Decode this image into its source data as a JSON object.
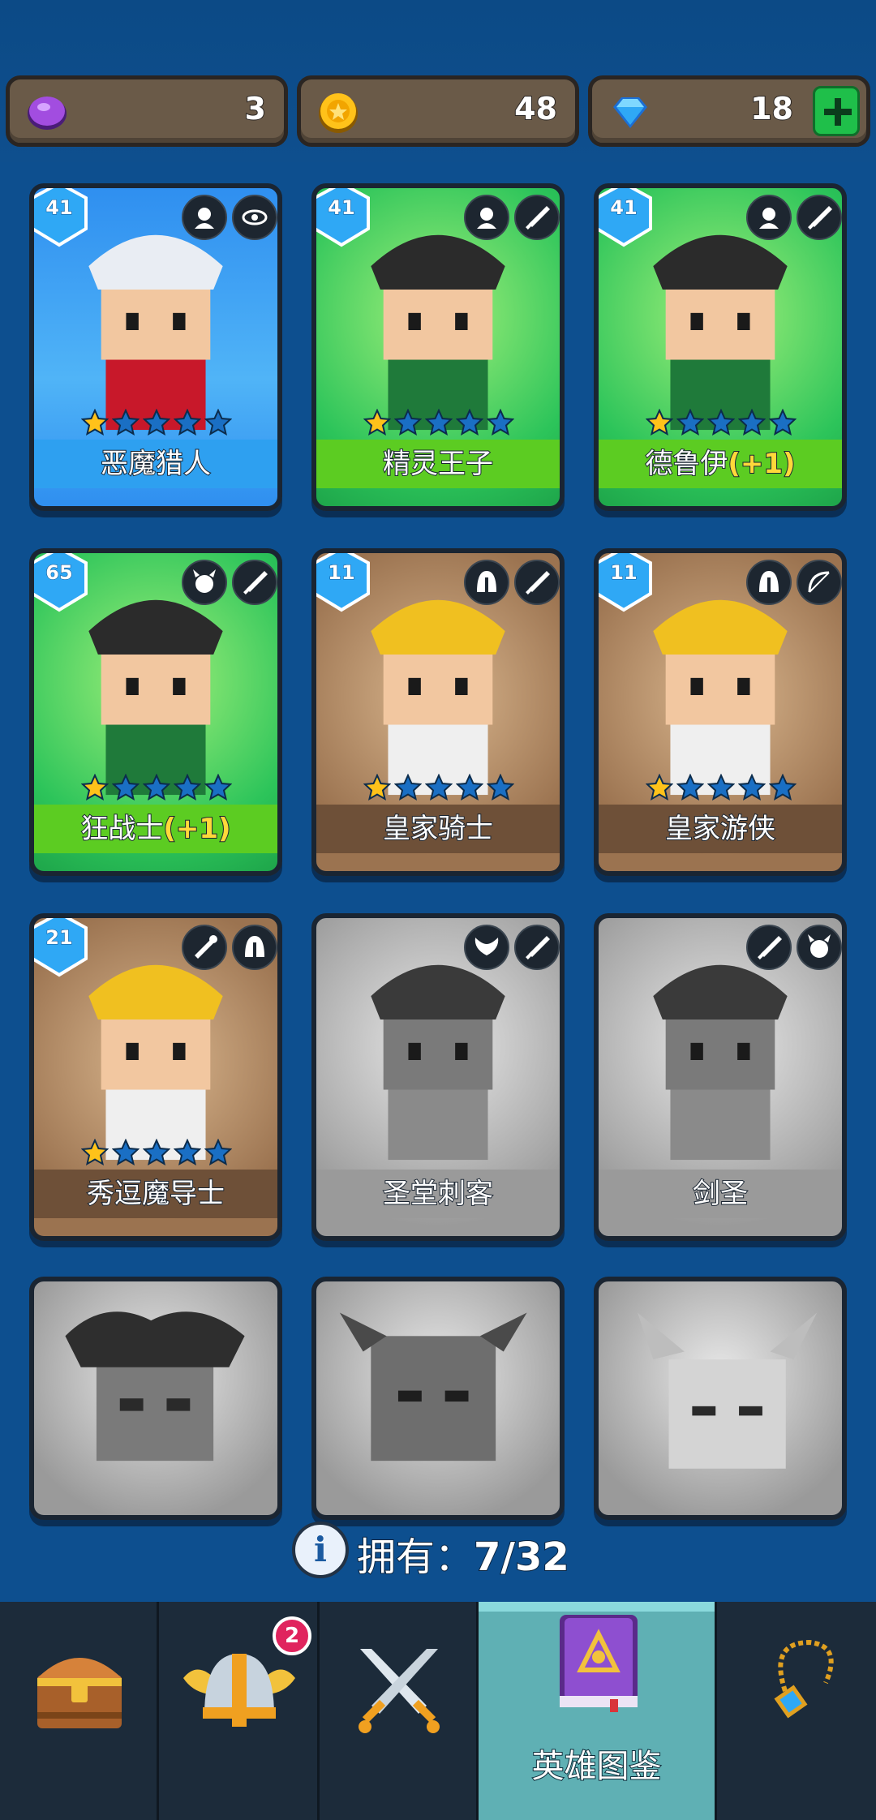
{
  "resources": {
    "gems": "3",
    "coins": "48",
    "diamonds": "18"
  },
  "heroes": [
    {
      "name": "恶魔猎人",
      "bonus": "",
      "level": "41",
      "theme": "blue",
      "stars": 1,
      "owned": true
    },
    {
      "name": "精灵王子",
      "bonus": "",
      "level": "41",
      "theme": "green",
      "stars": 1,
      "owned": true
    },
    {
      "name": "德鲁伊",
      "bonus": "(+1)",
      "level": "41",
      "theme": "green",
      "stars": 1,
      "owned": true
    },
    {
      "name": "狂战士",
      "bonus": "(+1)",
      "level": "65",
      "theme": "green",
      "stars": 1,
      "owned": true
    },
    {
      "name": "皇家骑士",
      "bonus": "",
      "level": "11",
      "theme": "brown",
      "stars": 1,
      "owned": true
    },
    {
      "name": "皇家游侠",
      "bonus": "",
      "level": "11",
      "theme": "brown",
      "stars": 1,
      "owned": true
    },
    {
      "name": "秀逗魔导士",
      "bonus": "",
      "level": "21",
      "theme": "brown",
      "stars": 1,
      "owned": true
    },
    {
      "name": "圣堂刺客",
      "bonus": "",
      "level": "",
      "theme": "gray",
      "stars": 0,
      "owned": false
    },
    {
      "name": "剑圣",
      "bonus": "",
      "level": "",
      "theme": "gray",
      "stars": 0,
      "owned": false
    }
  ],
  "collection": {
    "label": "拥有：",
    "count": "7/32"
  },
  "nav": {
    "tabs": [
      {
        "label": "",
        "icon": "treasure-chest-icon"
      },
      {
        "label": "",
        "icon": "viking-helmet-icon",
        "badge": "2"
      },
      {
        "label": "",
        "icon": "crossed-swords-icon"
      },
      {
        "label": "英雄图鉴",
        "icon": "hero-book-icon"
      },
      {
        "label": "",
        "icon": "amulet-icon"
      }
    ]
  },
  "colors": {
    "background": "#0d4f8f",
    "accent_green": "#5ccc22",
    "star_gold": "#ffc21a",
    "star_empty": "#1a6fc4"
  }
}
